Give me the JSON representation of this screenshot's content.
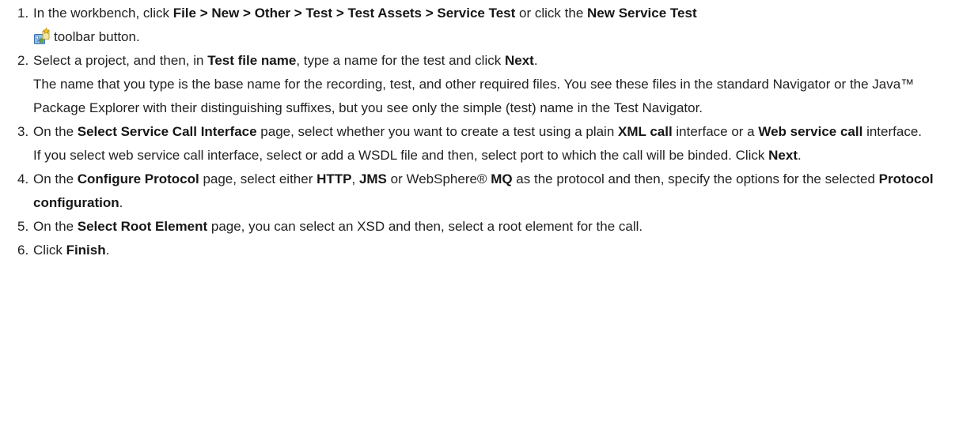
{
  "steps": [
    {
      "number": "1.",
      "t1": "In the workbench, click ",
      "b1": "File > New > Other > Test > Test Assets > Service Test",
      "t2": " or click the ",
      "b2": "New Service Test",
      "icon": "new-service-test-icon",
      "t3": "toolbar button."
    },
    {
      "number": "2.",
      "t1": "Select a project, and then, in ",
      "b1": "Test file name",
      "t2": ", type a name for the test and click ",
      "b2": "Next",
      "t3": ".",
      "note": "The name that you type is the base name for the recording, test, and other required files. You see these files in the standard Navigator or the Java™ Package Explorer with their distinguishing suffixes, but you see only the simple (test) name in the Test Navigator."
    },
    {
      "number": "3.",
      "t1": "On the ",
      "b1": "Select Service Call Interface",
      "t2": " page, select whether you want to create a test using a plain ",
      "b2": "XML call",
      "t3": " interface or a ",
      "b3": "Web service call",
      "t4": " interface.",
      "note": "If you select web service call interface, select or add a WSDL file and then, select port to which the call will be binded. Click ",
      "note_b": "Next",
      "note_end": "."
    },
    {
      "number": "4.",
      "t1": "On the ",
      "b1": "Configure Protocol",
      "t2": " page, select either ",
      "b2": "HTTP",
      "t3": ", ",
      "b3": "JMS",
      "t4": " or WebSphere® ",
      "b4": "MQ",
      "t5": " as the protocol and then, specify the options for the selected ",
      "b5": "Protocol configuration",
      "t6": "."
    },
    {
      "number": "5.",
      "t1": "On the ",
      "b1": "Select Root Element",
      "t2": " page, you can select an XSD and then, select a root element for the call."
    },
    {
      "number": "6.",
      "t1": "Click ",
      "b1": "Finish",
      "t2": "."
    }
  ]
}
